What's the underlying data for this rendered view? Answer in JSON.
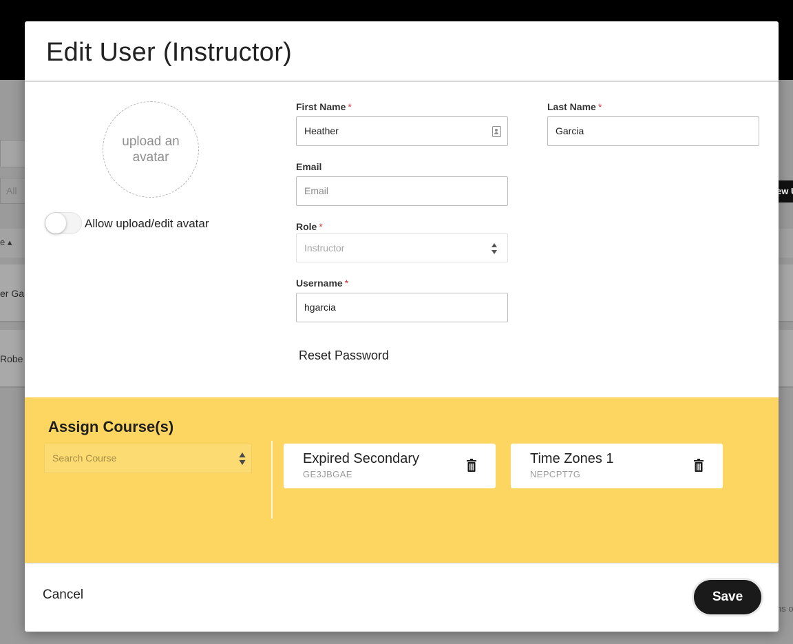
{
  "background": {
    "filter_label": "All",
    "header_sort_label": "e ▴",
    "rows": [
      "er Gar",
      "Robe"
    ],
    "new_button_label": "ew U",
    "footer_text": "ns o"
  },
  "modal": {
    "title": "Edit User (Instructor)",
    "avatar": {
      "upload_text": "upload an avatar",
      "toggle_label": "Allow upload/edit avatar",
      "toggle_on": false
    },
    "fields": {
      "first_name": {
        "label": "First Name",
        "required": "*",
        "value": "Heather"
      },
      "last_name": {
        "label": "Last Name",
        "required": "*",
        "value": "Garcia"
      },
      "email": {
        "label": "Email",
        "placeholder": "Email",
        "value": ""
      },
      "role": {
        "label": "Role",
        "required": "*",
        "value": "Instructor"
      },
      "username": {
        "label": "Username",
        "required": "*",
        "value": "hgarcia"
      }
    },
    "reset_password_label": "Reset Password",
    "assign": {
      "title": "Assign Course(s)",
      "search_placeholder": "Search Course",
      "courses": [
        {
          "name": "Expired Secondary",
          "code": "GE3JBGAE"
        },
        {
          "name": "Time Zones 1",
          "code": "NEPCPT7G"
        }
      ],
      "background_color": "#fdd661"
    },
    "footer": {
      "cancel_label": "Cancel",
      "save_label": "Save"
    }
  }
}
